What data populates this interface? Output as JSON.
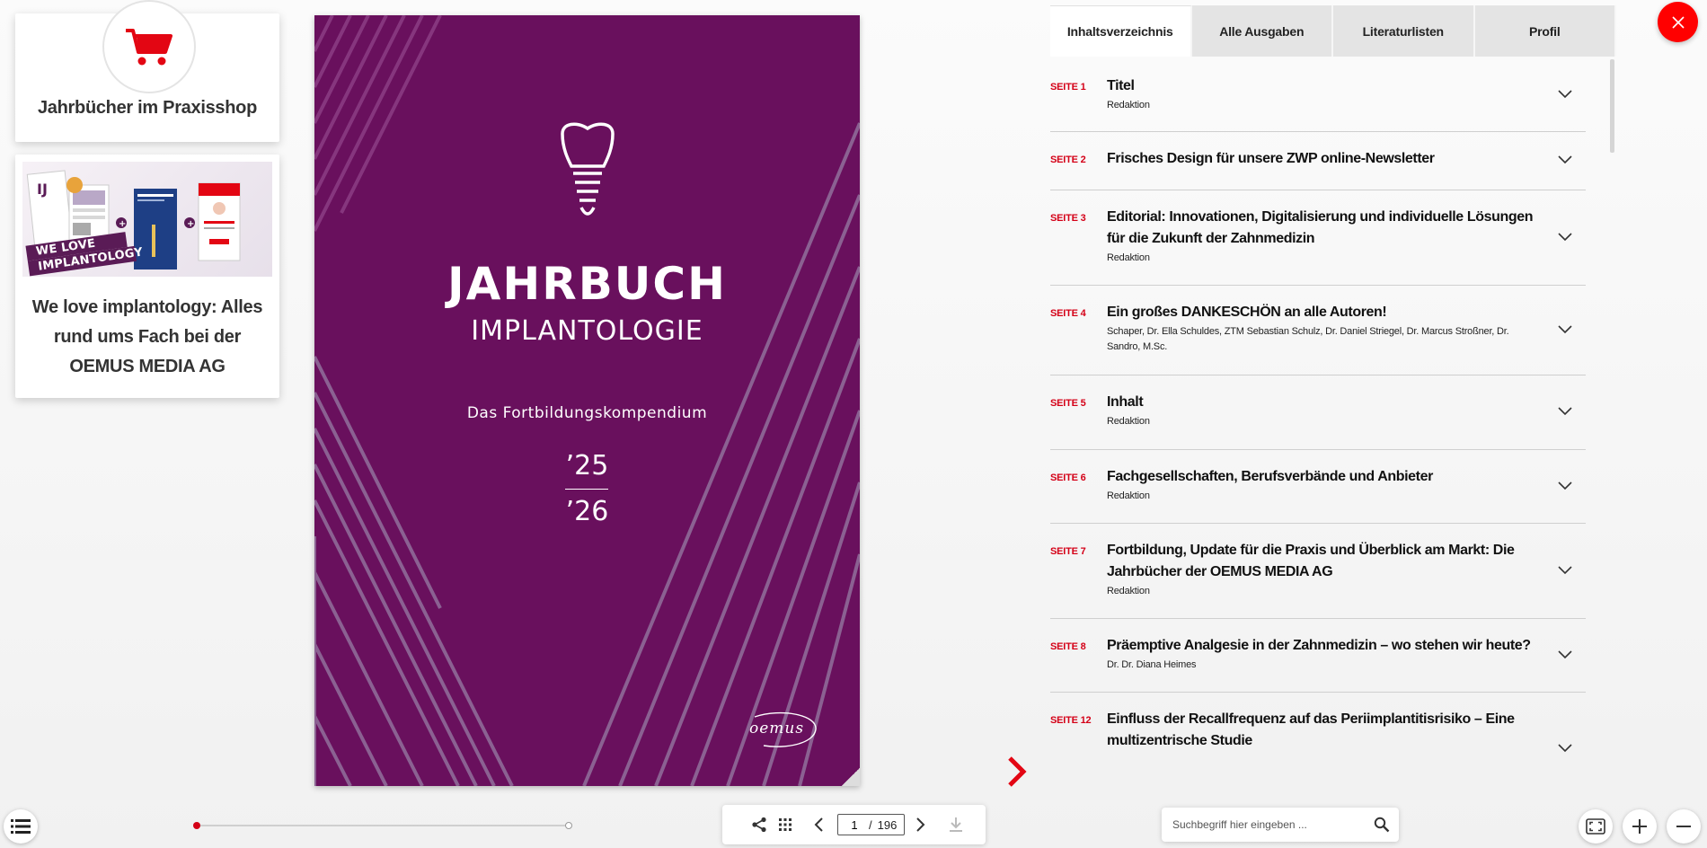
{
  "shop_card": {
    "label": "Jahrbücher im Praxisshop"
  },
  "promo_card": {
    "text": "We love implantology: Alles rund ums Fach bei der OEMUS MEDIA AG",
    "image_caption": "WE LOVE IMPLANTOLOGY"
  },
  "cover": {
    "title": "JAHRBUCH",
    "subtitle": "IMPLANTOLOGIE",
    "tagline": "Das Fortbildungskompendium",
    "year_top": "’25",
    "year_bottom": "’26",
    "publisher_logo": "oemus",
    "background_color": "#69105d"
  },
  "tabs": [
    {
      "label": "Inhaltsverzeichnis",
      "active": true
    },
    {
      "label": "Alle Ausgaben",
      "active": false
    },
    {
      "label": "Literaturlisten",
      "active": false
    },
    {
      "label": "Profil",
      "active": false
    }
  ],
  "toc": [
    {
      "page": "SEITE 1",
      "title": "Titel",
      "author": "Redaktion"
    },
    {
      "page": "SEITE 2",
      "title": "Frisches Design für unsere ZWP online-Newsletter",
      "author": ""
    },
    {
      "page": "SEITE 3",
      "title": "Editorial: Innovationen, Digitalisierung und individuelle Lösungen für die Zukunft der Zahnmedizin",
      "author": "Redaktion"
    },
    {
      "page": "SEITE 4",
      "title": "Ein großes DANKESCHÖN an alle Autoren!",
      "author": "Schaper, Dr. Ella Schuldes, ZTM Sebastian Schulz, Dr. Daniel Striegel, Dr. Marcus Stroßner, Dr. Sandro, M.Sc."
    },
    {
      "page": "SEITE 5",
      "title": "Inhalt",
      "author": "Redaktion"
    },
    {
      "page": "SEITE 6",
      "title": "Fachgesellschaften, Berufsverbände und Anbieter",
      "author": "Redaktion"
    },
    {
      "page": "SEITE 7",
      "title": "Fortbildung, Update für die Praxis und Überblick am Markt: Die Jahrbücher der OEMUS MEDIA AG",
      "author": "Redaktion"
    },
    {
      "page": "SEITE 8",
      "title": "Präemptive Analgesie in der Zahnmedizin – wo stehen wir heute?",
      "author": "Dr. Dr. Diana Heimes"
    },
    {
      "page": "SEITE 12",
      "title": "Einfluss der Recallfrequenz auf das Periimplantitisrisiko – Eine multizentrische Studie",
      "author": ""
    }
  ],
  "navigation": {
    "current_page": "1",
    "separator": "/",
    "total_pages": "196"
  },
  "progress": {
    "fraction": 0.005
  },
  "search": {
    "placeholder": "Suchbegriff hier eingeben ..."
  },
  "colors": {
    "accent": "#d40017",
    "close": "#ff0000"
  },
  "icons": {
    "shop": "cart-icon",
    "close": "close-icon",
    "toc": "list-icon",
    "share": "share-icon",
    "grid": "grid-icon",
    "prev": "chevron-left-icon",
    "next": "chevron-right-icon",
    "download": "download-icon",
    "search": "search-icon",
    "fit": "fit-screen-icon",
    "zoom_in": "plus-icon",
    "zoom_out": "minus-icon"
  }
}
